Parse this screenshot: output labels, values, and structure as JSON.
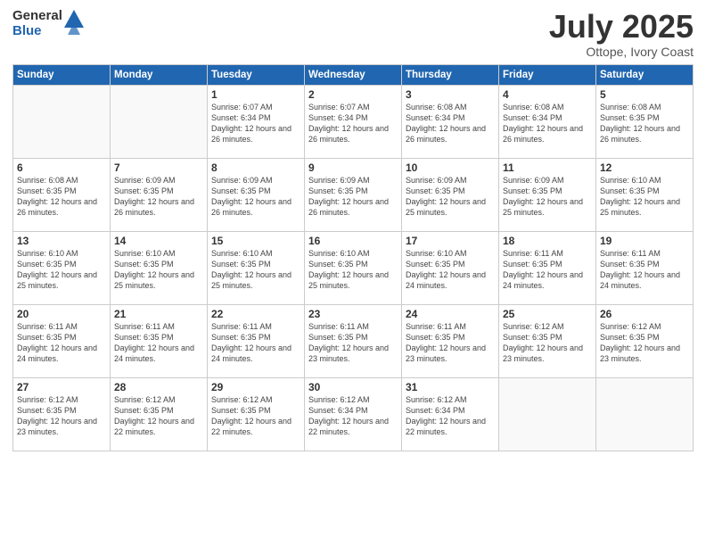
{
  "logo": {
    "general": "General",
    "blue": "Blue"
  },
  "header": {
    "month": "July 2025",
    "location": "Ottope, Ivory Coast"
  },
  "days_of_week": [
    "Sunday",
    "Monday",
    "Tuesday",
    "Wednesday",
    "Thursday",
    "Friday",
    "Saturday"
  ],
  "weeks": [
    [
      {
        "day": "",
        "info": ""
      },
      {
        "day": "",
        "info": ""
      },
      {
        "day": "1",
        "info": "Sunrise: 6:07 AM\nSunset: 6:34 PM\nDaylight: 12 hours and 26 minutes."
      },
      {
        "day": "2",
        "info": "Sunrise: 6:07 AM\nSunset: 6:34 PM\nDaylight: 12 hours and 26 minutes."
      },
      {
        "day": "3",
        "info": "Sunrise: 6:08 AM\nSunset: 6:34 PM\nDaylight: 12 hours and 26 minutes."
      },
      {
        "day": "4",
        "info": "Sunrise: 6:08 AM\nSunset: 6:34 PM\nDaylight: 12 hours and 26 minutes."
      },
      {
        "day": "5",
        "info": "Sunrise: 6:08 AM\nSunset: 6:35 PM\nDaylight: 12 hours and 26 minutes."
      }
    ],
    [
      {
        "day": "6",
        "info": "Sunrise: 6:08 AM\nSunset: 6:35 PM\nDaylight: 12 hours and 26 minutes."
      },
      {
        "day": "7",
        "info": "Sunrise: 6:09 AM\nSunset: 6:35 PM\nDaylight: 12 hours and 26 minutes."
      },
      {
        "day": "8",
        "info": "Sunrise: 6:09 AM\nSunset: 6:35 PM\nDaylight: 12 hours and 26 minutes."
      },
      {
        "day": "9",
        "info": "Sunrise: 6:09 AM\nSunset: 6:35 PM\nDaylight: 12 hours and 26 minutes."
      },
      {
        "day": "10",
        "info": "Sunrise: 6:09 AM\nSunset: 6:35 PM\nDaylight: 12 hours and 25 minutes."
      },
      {
        "day": "11",
        "info": "Sunrise: 6:09 AM\nSunset: 6:35 PM\nDaylight: 12 hours and 25 minutes."
      },
      {
        "day": "12",
        "info": "Sunrise: 6:10 AM\nSunset: 6:35 PM\nDaylight: 12 hours and 25 minutes."
      }
    ],
    [
      {
        "day": "13",
        "info": "Sunrise: 6:10 AM\nSunset: 6:35 PM\nDaylight: 12 hours and 25 minutes."
      },
      {
        "day": "14",
        "info": "Sunrise: 6:10 AM\nSunset: 6:35 PM\nDaylight: 12 hours and 25 minutes."
      },
      {
        "day": "15",
        "info": "Sunrise: 6:10 AM\nSunset: 6:35 PM\nDaylight: 12 hours and 25 minutes."
      },
      {
        "day": "16",
        "info": "Sunrise: 6:10 AM\nSunset: 6:35 PM\nDaylight: 12 hours and 25 minutes."
      },
      {
        "day": "17",
        "info": "Sunrise: 6:10 AM\nSunset: 6:35 PM\nDaylight: 12 hours and 24 minutes."
      },
      {
        "day": "18",
        "info": "Sunrise: 6:11 AM\nSunset: 6:35 PM\nDaylight: 12 hours and 24 minutes."
      },
      {
        "day": "19",
        "info": "Sunrise: 6:11 AM\nSunset: 6:35 PM\nDaylight: 12 hours and 24 minutes."
      }
    ],
    [
      {
        "day": "20",
        "info": "Sunrise: 6:11 AM\nSunset: 6:35 PM\nDaylight: 12 hours and 24 minutes."
      },
      {
        "day": "21",
        "info": "Sunrise: 6:11 AM\nSunset: 6:35 PM\nDaylight: 12 hours and 24 minutes."
      },
      {
        "day": "22",
        "info": "Sunrise: 6:11 AM\nSunset: 6:35 PM\nDaylight: 12 hours and 24 minutes."
      },
      {
        "day": "23",
        "info": "Sunrise: 6:11 AM\nSunset: 6:35 PM\nDaylight: 12 hours and 23 minutes."
      },
      {
        "day": "24",
        "info": "Sunrise: 6:11 AM\nSunset: 6:35 PM\nDaylight: 12 hours and 23 minutes."
      },
      {
        "day": "25",
        "info": "Sunrise: 6:12 AM\nSunset: 6:35 PM\nDaylight: 12 hours and 23 minutes."
      },
      {
        "day": "26",
        "info": "Sunrise: 6:12 AM\nSunset: 6:35 PM\nDaylight: 12 hours and 23 minutes."
      }
    ],
    [
      {
        "day": "27",
        "info": "Sunrise: 6:12 AM\nSunset: 6:35 PM\nDaylight: 12 hours and 23 minutes."
      },
      {
        "day": "28",
        "info": "Sunrise: 6:12 AM\nSunset: 6:35 PM\nDaylight: 12 hours and 22 minutes."
      },
      {
        "day": "29",
        "info": "Sunrise: 6:12 AM\nSunset: 6:35 PM\nDaylight: 12 hours and 22 minutes."
      },
      {
        "day": "30",
        "info": "Sunrise: 6:12 AM\nSunset: 6:34 PM\nDaylight: 12 hours and 22 minutes."
      },
      {
        "day": "31",
        "info": "Sunrise: 6:12 AM\nSunset: 6:34 PM\nDaylight: 12 hours and 22 minutes."
      },
      {
        "day": "",
        "info": ""
      },
      {
        "day": "",
        "info": ""
      }
    ]
  ]
}
